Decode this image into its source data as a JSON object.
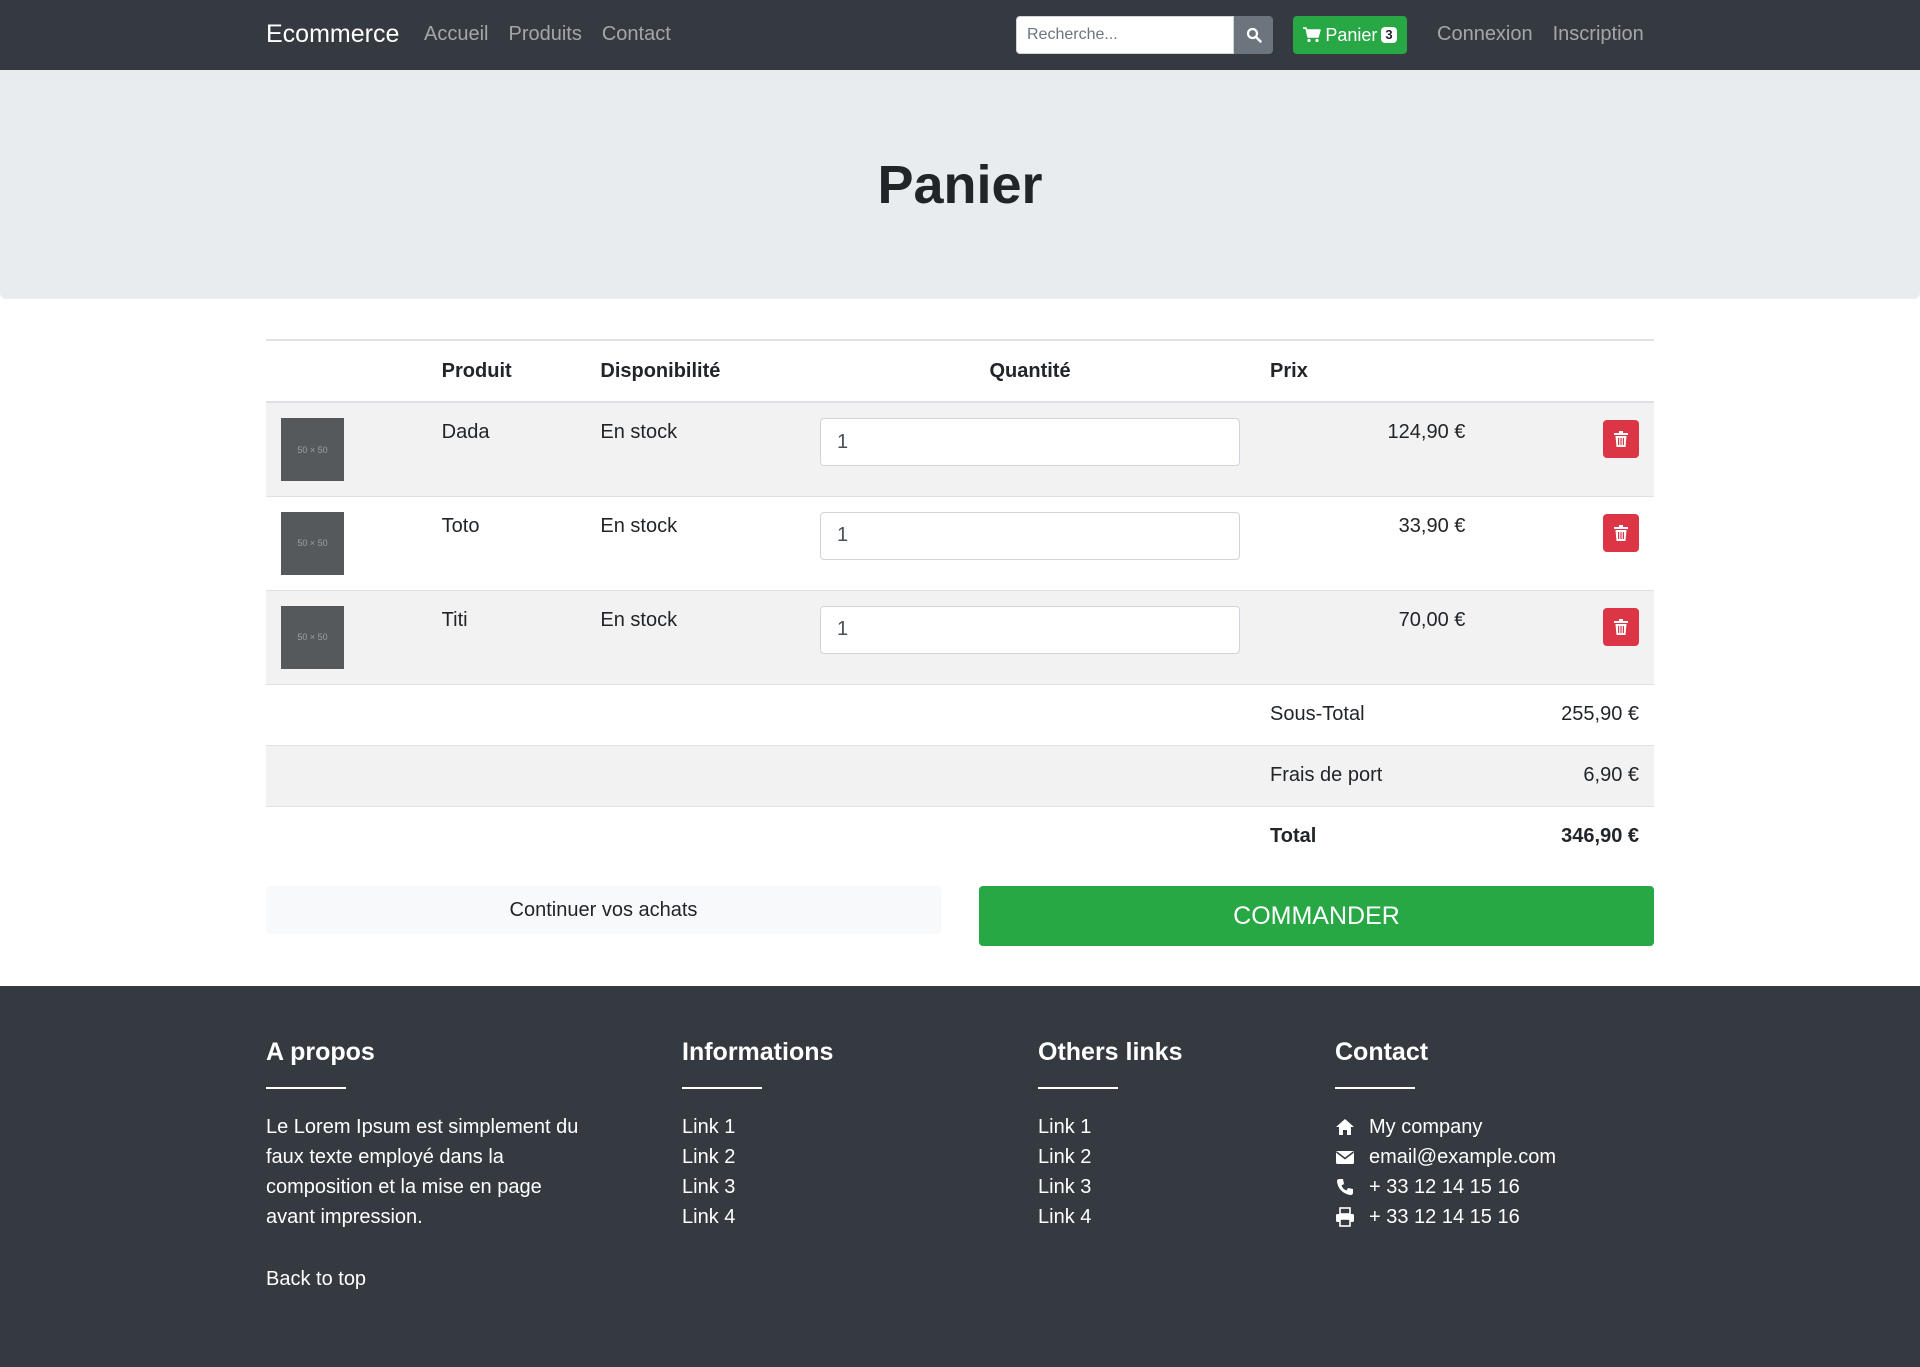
{
  "navbar": {
    "brand": "Ecommerce",
    "links": [
      "Accueil",
      "Produits",
      "Contact"
    ],
    "search_placeholder": "Recherche...",
    "cart_label": "Panier",
    "cart_count": "3",
    "auth_links": [
      "Connexion",
      "Inscription"
    ]
  },
  "hero": {
    "title": "Panier"
  },
  "table": {
    "headers": {
      "product": "Produit",
      "availability": "Disponibilité",
      "quantity": "Quantité",
      "price": "Prix"
    },
    "thumb_label": "50 × 50",
    "items": [
      {
        "name": "Dada",
        "availability": "En stock",
        "quantity": "1",
        "price": "124,90 €"
      },
      {
        "name": "Toto",
        "availability": "En stock",
        "quantity": "1",
        "price": "33,90 €"
      },
      {
        "name": "Titi",
        "availability": "En stock",
        "quantity": "1",
        "price": "70,00 €"
      }
    ],
    "summary": {
      "subtotal_label": "Sous-Total",
      "subtotal": "255,90 €",
      "shipping_label": "Frais de port",
      "shipping": "6,90 €",
      "total_label": "Total",
      "total": "346,90 €"
    }
  },
  "actions": {
    "continue": "Continuer vos achats",
    "order": "COMMANDER"
  },
  "footer": {
    "about": {
      "title": "A propos",
      "text": "Le Lorem Ipsum est simplement du faux texte employé dans la composition et la mise en page avant impression."
    },
    "info": {
      "title": "Informations",
      "links": [
        "Link 1",
        "Link 2",
        "Link 3",
        "Link 4"
      ]
    },
    "others": {
      "title": "Others links",
      "links": [
        "Link 1",
        "Link 2",
        "Link 3",
        "Link 4"
      ]
    },
    "contact": {
      "title": "Contact",
      "company": "My company",
      "email": "email@example.com",
      "phone": "+ 33 12 14 15 16",
      "fax": "+ 33 12 14 15 16"
    },
    "back_to_top": "Back to top"
  },
  "colors": {
    "navbar": "#343a40",
    "success": "#28a745",
    "danger": "#dc3545",
    "hero": "#e9ecef"
  },
  "icons": [
    "search-icon",
    "shopping-cart-icon",
    "trash-icon",
    "home-icon",
    "envelope-icon",
    "phone-icon",
    "print-icon"
  ]
}
